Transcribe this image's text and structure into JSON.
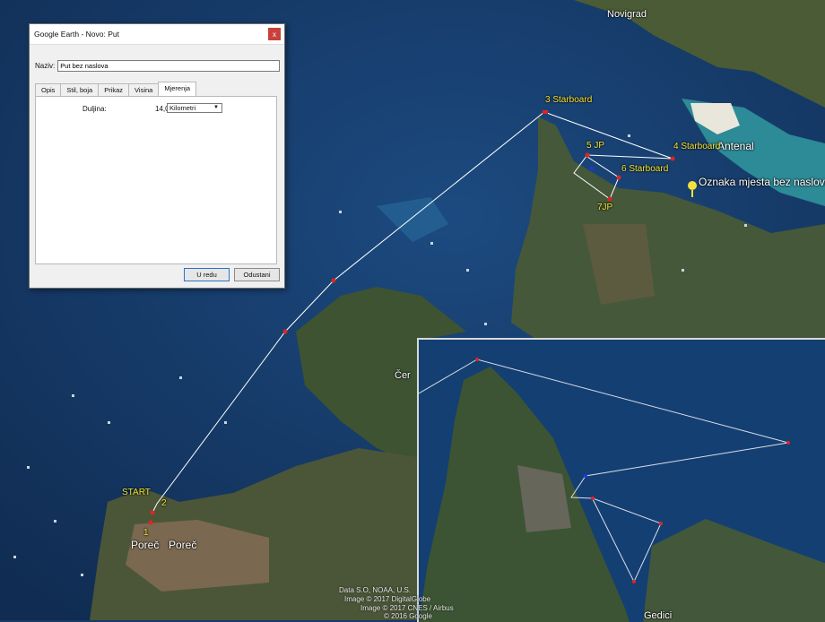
{
  "dialog": {
    "title": "Google Earth - Novo: Put",
    "close_label": "x",
    "name_label": "Naziv:",
    "name_value": "Put bez naslova",
    "tabs": [
      "Opis",
      "Stil, boja",
      "Prikaz",
      "Visina",
      "Mjerenja"
    ],
    "active_tab": "Mjerenja",
    "length_label": "Duljina:",
    "length_value": "14,0",
    "unit_selected": "Kilometri",
    "ok_label": "U redu",
    "cancel_label": "Odustani"
  },
  "map": {
    "places": {
      "novigrad": "Novigrad",
      "antenal": "Antenal",
      "porec1": "Poreč",
      "porec2": "Poreč",
      "cervar": "Čer",
      "gedici": "Gedici"
    },
    "waypoints": {
      "start": "START",
      "p1": "1",
      "p2": "2",
      "p3": "3 Starboard",
      "p4": "4 Starboard",
      "p5": "5 JP",
      "p6": "6 Starboard",
      "p7": "7JP"
    },
    "placemark_label": "Oznaka mjesta bez naslova",
    "attribution": {
      "line1": "Data S.O, NOAA, U.S.",
      "line2": "Image © 2017 DigitalGlobe",
      "line3": "Image © 2017 CNES / Airbus",
      "line4": "© 2016 Google"
    },
    "colors": {
      "sea": "#173a66",
      "land": "#3f5630",
      "route": "#ffffff",
      "waypoint": "#e02424",
      "label": "#f3e63a"
    }
  }
}
